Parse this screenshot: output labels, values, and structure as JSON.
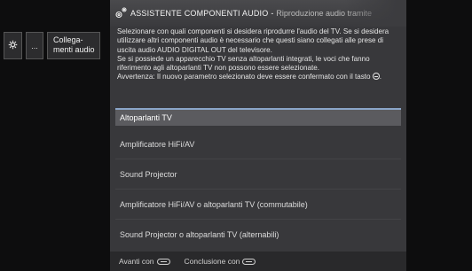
{
  "breadcrumb": {
    "gear_icon": "gear-icon",
    "ellipsis": "...",
    "label_line1": "Collega-",
    "label_line2": "menti audio"
  },
  "dialog": {
    "title_icon": "audio-components-icon",
    "title": "ASSISTENTE COMPONENTI AUDIO",
    "separator": "-",
    "subtitle": "Riproduzione audio tramite",
    "description_main": "Selezionare con quali componenti si desidera riprodurre l'audio del TV. Se si desidera utilizzare altri componenti audio è necessario che questi siano collegati alle prese di uscita audio AUDIO DIGITAL OUT del televisore.\nSe si possiede un apparecchio TV senza altoparlanti integrati, le voci che fanno riferimento agli altoparlanti TV non possono essere selezionate.\nAvvertenza: Il nuovo parametro selezionato deve essere confermato con il tasto ",
    "description_ok_icon": "ok-button-icon",
    "description_end": ".",
    "options": [
      {
        "label": "Altoparlanti TV",
        "selected": true
      },
      {
        "label": "Amplificatore HiFi/AV",
        "selected": false
      },
      {
        "label": "Sound Projector",
        "selected": false
      },
      {
        "label": "Amplificatore HiFi/AV o altoparlanti TV (commutabile)",
        "selected": false
      },
      {
        "label": "Sound Projector o altoparlanti TV (alternabili)",
        "selected": false
      }
    ],
    "footer": {
      "next_label": "Avanti con",
      "next_icon": "ok-key-icon",
      "finish_label": "Conclusione con",
      "finish_icon": "end-key-icon"
    }
  },
  "colors": {
    "background": "#0d0d0e",
    "dialog": "#38383b",
    "selected_row": "#5b5b5f",
    "selection_accent": "#8aa5c8"
  }
}
